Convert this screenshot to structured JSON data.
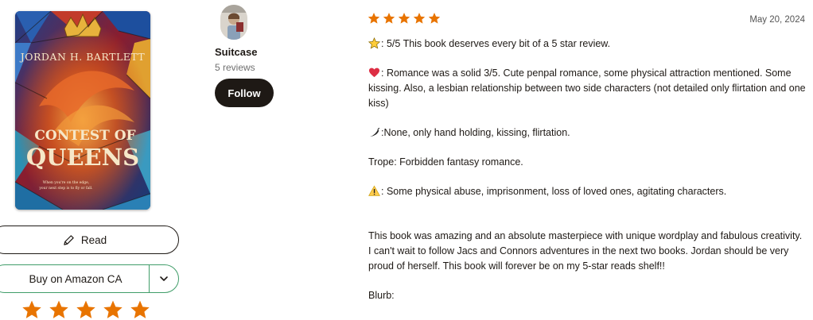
{
  "book": {
    "cover": {
      "author": "JORDAN H. BARTLETT",
      "title_line1": "CONTEST OF",
      "title_line2": "QUEENS",
      "tagline_line1": "When you're on the edge,",
      "tagline_line2": "your next step is to fly or fall."
    },
    "read_button": "Read",
    "buy_button": "Buy on Amazon CA",
    "user_rating_stars": 5,
    "colors": {
      "star": "#e87400",
      "buy_border": "#409d69"
    }
  },
  "reviewer": {
    "name": "Suitcase",
    "review_count": "5 reviews",
    "follow_label": "Follow"
  },
  "review": {
    "rating": 5,
    "date": "May 20, 2024",
    "paragraphs": {
      "rating_line": ": 5/5 This book deserves every bit of a 5 star review.",
      "romance_line": ": Romance was a solid 3/5. Cute penpal romance, some physical attraction mentioned. Some kissing. Also, a lesbian relationship between two side characters (not detailed only flirtation and one kiss)",
      "spice_line": ":None, only hand holding, kissing, flirtation.",
      "trope_line": "Trope: Forbidden fantasy romance.",
      "warning_line": ": Some physical abuse, imprisonment, loss of loved ones, agitating characters.",
      "summary": "This book was amazing and an absolute masterpiece with unique wordplay and fabulous creativity. I can't wait to follow Jacs and Connors adventures in the next two books. Jordan should be very proud of herself. This book will forever be on my 5-star reads shelf!!",
      "blurb_label": "Blurb:"
    },
    "icons": [
      "star-emoji-icon",
      "red-heart-emoji-icon",
      "chili-pepper-emoji-icon",
      "warning-emoji-icon"
    ]
  }
}
